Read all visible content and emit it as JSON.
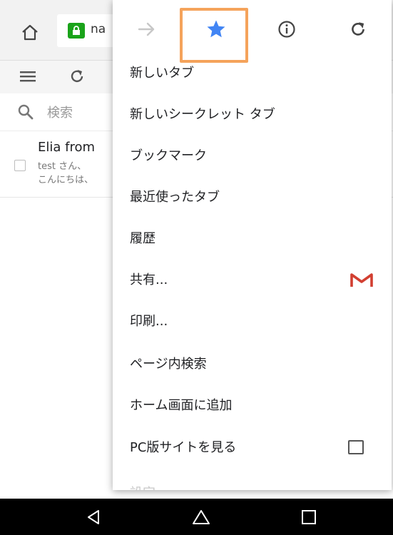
{
  "browser": {
    "url_fragment": "na",
    "icons": {
      "home": "home-icon",
      "lock": "lock-icon"
    }
  },
  "gmail": {
    "search_placeholder": "検索",
    "email": {
      "sender": "Elia from",
      "snippet_line1": "test さん、",
      "snippet_line2": "こんにちは、"
    },
    "icons": {
      "menu": "hamburger-icon",
      "refresh": "refresh-icon",
      "search": "search-icon"
    }
  },
  "menu": {
    "top_icons": [
      "forward-arrow-icon",
      "bookmark-star-icon",
      "info-icon",
      "reload-icon"
    ],
    "items": [
      {
        "label": "新しいタブ"
      },
      {
        "label": "新しいシークレット タブ"
      },
      {
        "label": "ブックマーク"
      },
      {
        "label": "最近使ったタブ"
      },
      {
        "label": "履歴"
      },
      {
        "label": "共有..."
      },
      {
        "label": "印刷..."
      },
      {
        "label": "ページ内検索"
      },
      {
        "label": "ホーム画面に追加"
      },
      {
        "label": "PC版サイトを見る"
      },
      {
        "label": "設定"
      }
    ]
  },
  "navbar": {
    "icons": [
      "back-icon",
      "home-icon",
      "recents-icon"
    ]
  },
  "colors": {
    "accent_star": "#4285f4",
    "highlight_box": "#f5a35b",
    "lock_green": "#1aa31a",
    "gmail_red": "#d23f31"
  }
}
